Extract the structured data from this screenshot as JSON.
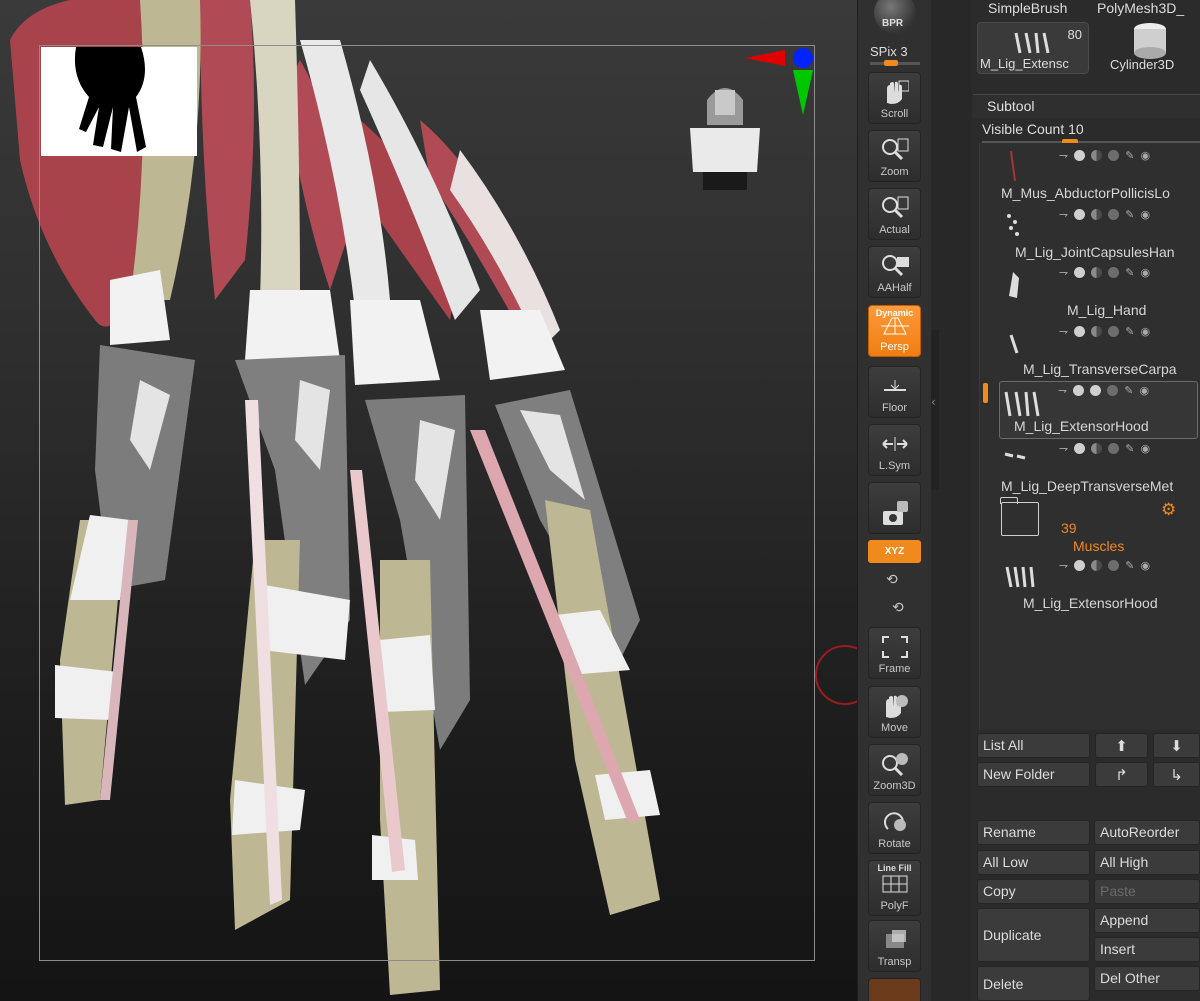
{
  "shelf": {
    "bpr": "BPR",
    "spix": "SPix 3",
    "scroll": "Scroll",
    "zoom": "Zoom",
    "actual": "Actual",
    "aahalf": "AAHalf",
    "dynamic": "Dynamic",
    "persp": "Persp",
    "floor": "Floor",
    "lsym": "L.Sym",
    "xyz": "XYZ",
    "frame": "Frame",
    "move": "Move",
    "zoom3d": "Zoom3D",
    "rotate": "Rotate",
    "linefill": "Line Fill",
    "polyf": "PolyF",
    "transp": "Transp"
  },
  "tool": {
    "brush_tab": "SimpleBrush",
    "mesh_tab": "PolyMesh3D_",
    "current_tool": "M_Lig_Extensc",
    "current_count": "80",
    "cylinder": "Cylinder3D"
  },
  "subtool": {
    "title": "Subtool",
    "visible_count": "Visible Count 10",
    "items": [
      {
        "name": "M_Mus_AbductorPollicisLo"
      },
      {
        "name": "M_Lig_JointCapsulesHan"
      },
      {
        "name": "M_Lig_Hand"
      },
      {
        "name": "M_Lig_TransverseCarpa"
      },
      {
        "name": "M_Lig_ExtensorHood"
      },
      {
        "name": "M_Lig_DeepTransverseMet"
      },
      {
        "name": "M_Lig_ExtensorHood"
      }
    ],
    "folder": {
      "count": "39",
      "name": "Muscles"
    }
  },
  "buttons": {
    "list_all": "List All",
    "new_folder": "New Folder",
    "rename": "Rename",
    "auto_reorder": "AutoReorder",
    "all_low": "All Low",
    "all_high": "All High",
    "copy": "Copy",
    "paste": "Paste",
    "duplicate": "Duplicate",
    "append": "Append",
    "insert": "Insert",
    "delete": "Delete",
    "del_other": "Del Other"
  },
  "colors": {
    "accent": "#f08a1c",
    "panel": "#2b2b2b",
    "muscle": "#b04a55",
    "bone": "#bdb793",
    "ligament": "#ececec",
    "hood": "#7c7c7c"
  }
}
